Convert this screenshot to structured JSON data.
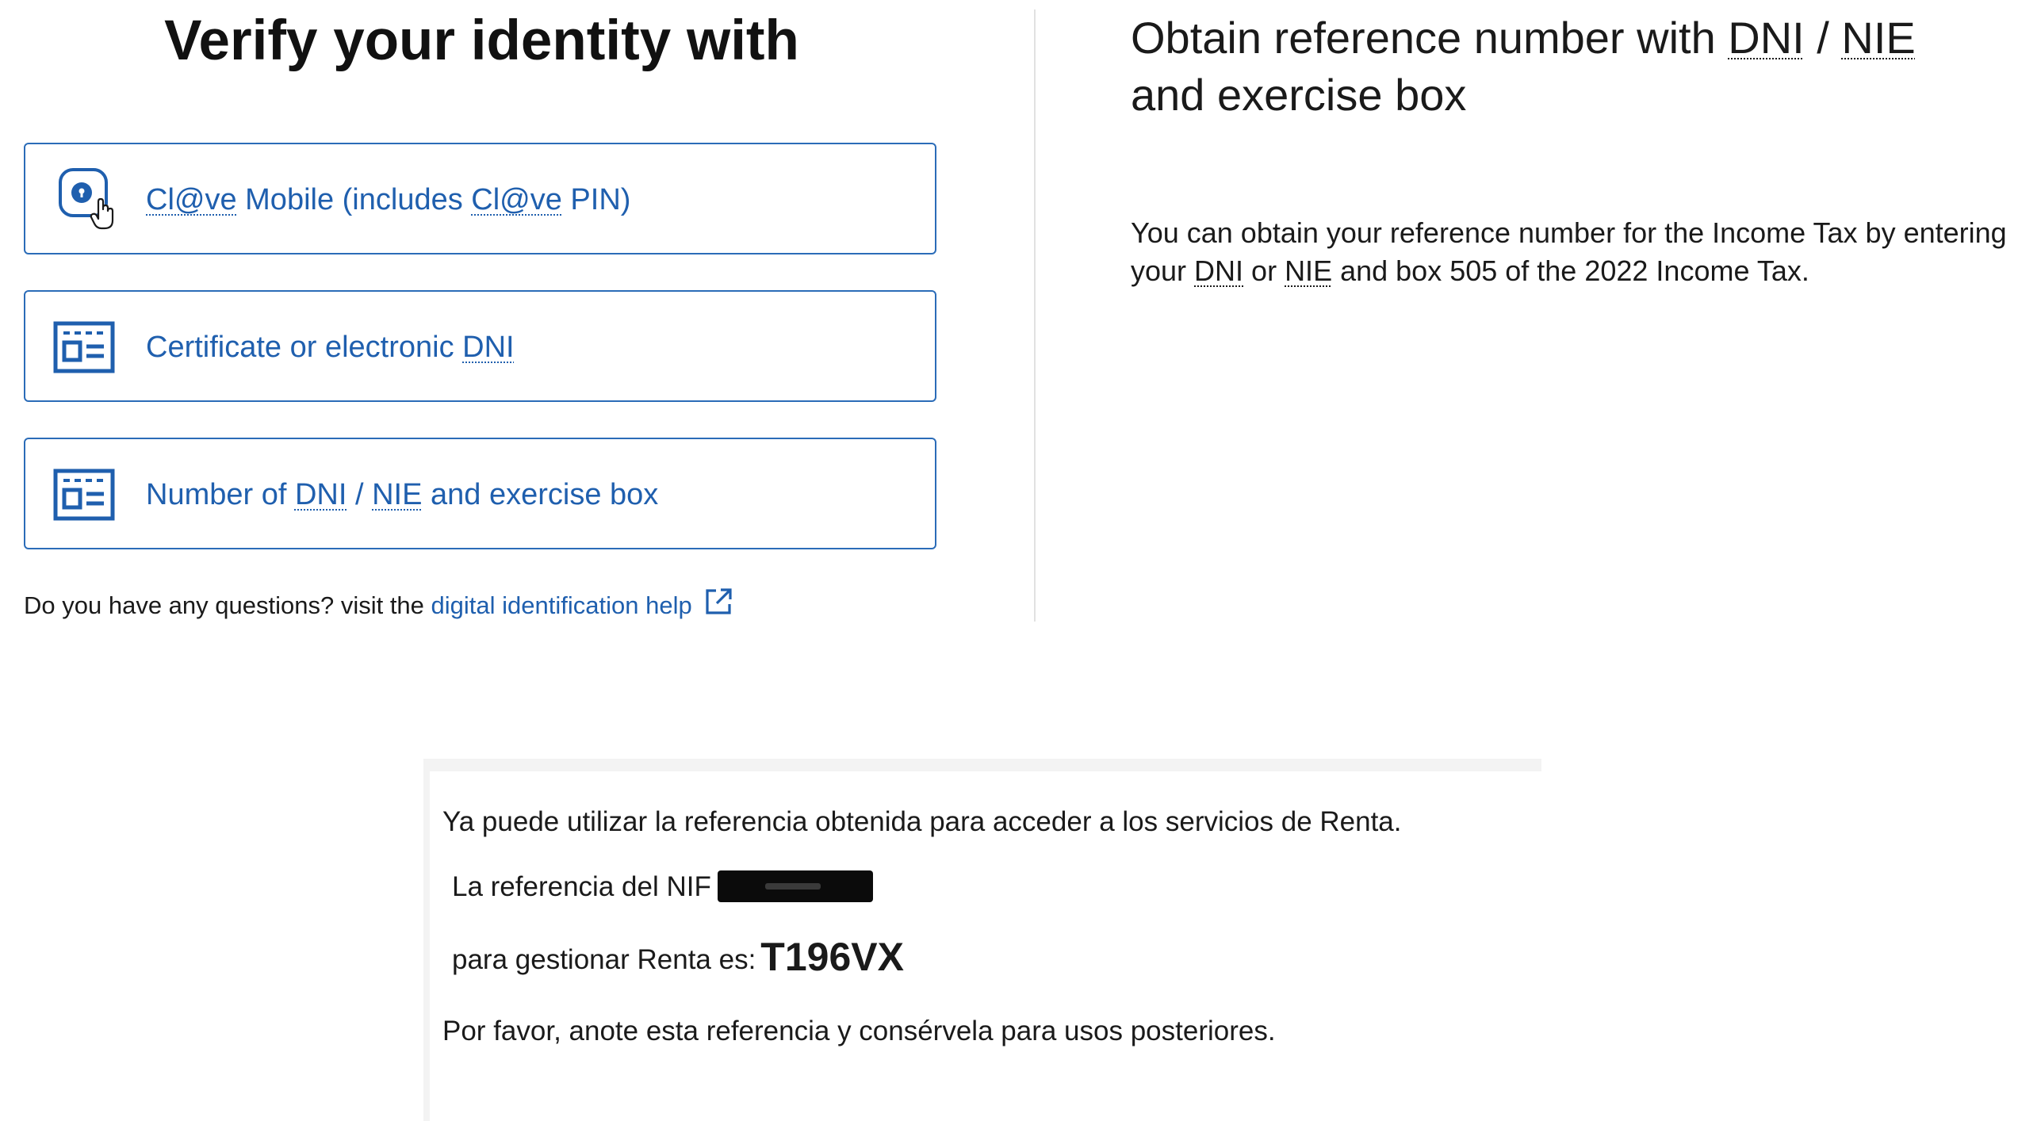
{
  "left": {
    "title": "Verify your identity with",
    "options": [
      {
        "id": "clave",
        "label_parts": [
          "Cl@ve",
          " Mobile (includes ",
          "Cl@ve",
          " PIN)"
        ],
        "icon": "clave-mobile-hand-icon"
      },
      {
        "id": "certificate",
        "label_parts": [
          "Certificate or electronic ",
          "DNI"
        ],
        "icon": "id-card-icon"
      },
      {
        "id": "dni-nie",
        "label_parts": [
          "Number of ",
          "DNI",
          " / ",
          "NIE",
          " and exercise box"
        ],
        "icon": "id-card-icon"
      }
    ],
    "help": {
      "prefix": "Do you have any questions? visit the ",
      "link_text": "digital identification help",
      "icon": "external-link-icon"
    }
  },
  "right": {
    "title_parts": [
      "Obtain reference number with ",
      "DNI",
      " / ",
      "NIE",
      " and exercise box"
    ],
    "desc_parts": [
      "You can obtain your reference number for the Income Tax by entering your ",
      "DNI",
      " or ",
      "NIE",
      " and box 505 of the 2022 Income Tax."
    ]
  },
  "notice": {
    "line1": "Ya puede utilizar la referencia obtenida para acceder a los servicios de Renta.",
    "line2_prefix": "La referencia del NIF",
    "line3_prefix": "para gestionar Renta es:",
    "reference_code": "T196VX",
    "line4": "Por favor, anote esta referencia y consérvela para usos posteriores."
  },
  "colors": {
    "accent": "#1f5fae",
    "card_border": "#2b6cb8",
    "divider": "#e1e1e1"
  }
}
